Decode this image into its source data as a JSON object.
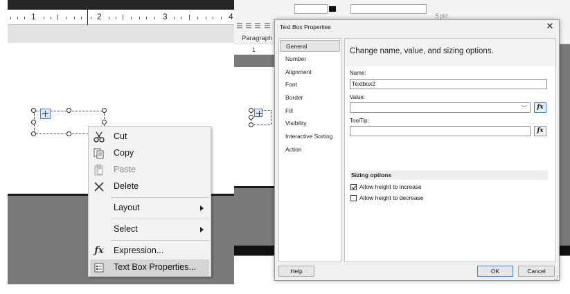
{
  "left": {
    "ruler_numbers": [
      "1",
      "2",
      "3",
      "4"
    ]
  },
  "context_menu": {
    "items": [
      {
        "label": "Cut",
        "icon": "scissors-icon",
        "enabled": true
      },
      {
        "label": "Copy",
        "icon": "copy-icon",
        "enabled": true
      },
      {
        "label": "Paste",
        "icon": "paste-icon",
        "enabled": false
      },
      {
        "label": "Delete",
        "icon": "delete-x-icon",
        "enabled": true
      },
      {
        "label": "Layout",
        "submenu": true
      },
      {
        "label": "Select",
        "submenu": true
      },
      {
        "label": "Expression...",
        "icon": "fx-icon"
      },
      {
        "label": "Text Box Properties...",
        "icon": "properties-icon",
        "highlighted": true
      }
    ]
  },
  "ribbon": {
    "group_label": "Paragraph",
    "split_label": "Split",
    "ruler_number": "1"
  },
  "dialog": {
    "title": "Text Box Properties",
    "nav": [
      "General",
      "Number",
      "Alignment",
      "Font",
      "Border",
      "Fill",
      "Visibility",
      "Interactive Sorting",
      "Action"
    ],
    "selected_nav": "General",
    "header": "Change name, value, and sizing options.",
    "name_label": "Name:",
    "name_value": "Textbox2",
    "value_label": "Value:",
    "value_value": "",
    "tooltip_label": "ToolTip:",
    "tooltip_value": "",
    "fx_label": "fx",
    "sizing_header": "Sizing options",
    "allow_increase": {
      "label": "Allow height to increase",
      "checked": true
    },
    "allow_decrease": {
      "label": "Allow height to decrease",
      "checked": false
    },
    "buttons": {
      "help": "Help",
      "ok": "OK",
      "cancel": "Cancel"
    }
  }
}
